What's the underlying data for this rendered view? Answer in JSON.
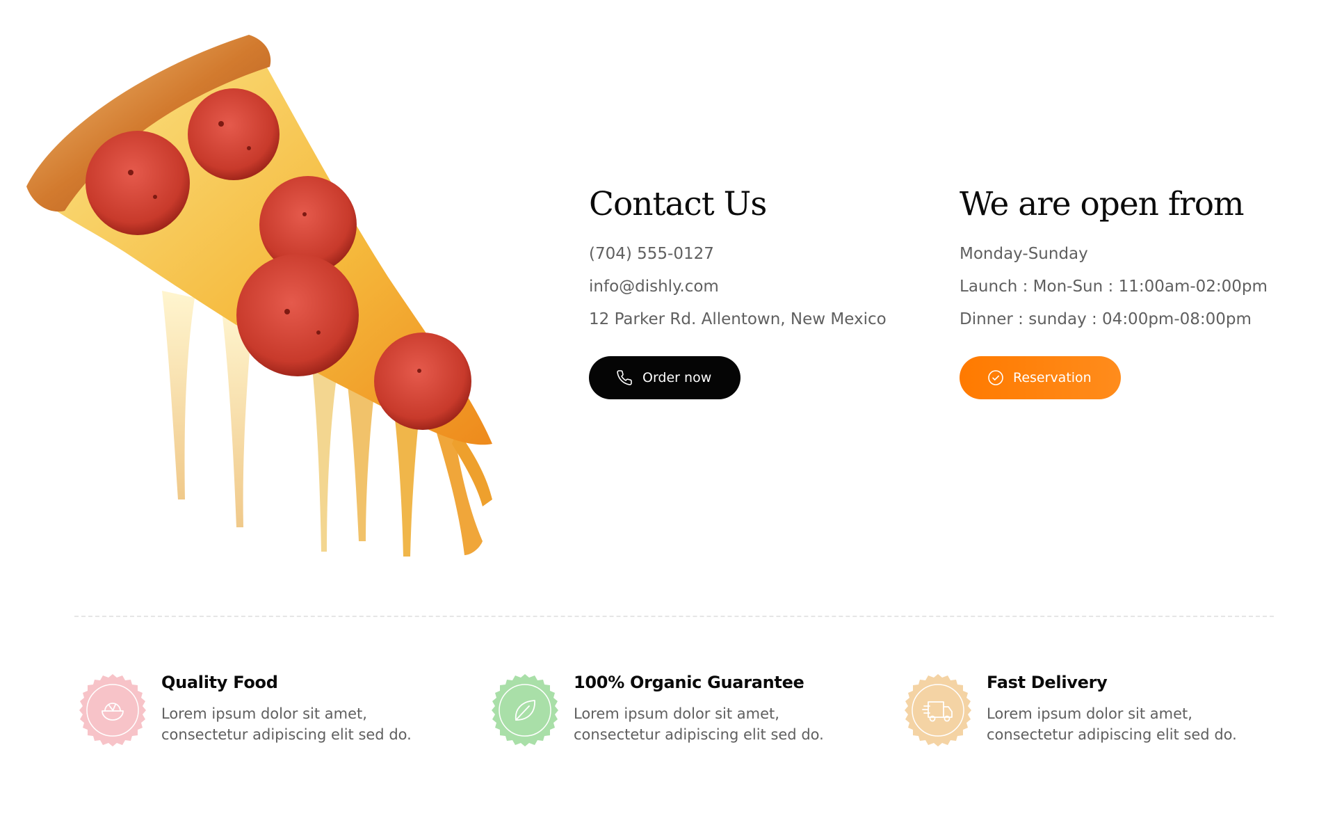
{
  "contact": {
    "heading": "Contact Us",
    "phone": "(704) 555-0127",
    "email": "info@dishly.com",
    "address": "12 Parker Rd. Allentown, New Mexico",
    "button_label": "Order now",
    "button_icon": "phone-icon"
  },
  "hours": {
    "heading": "We are open from",
    "days": "Monday-Sunday",
    "launch": "Launch : Mon-Sun : 11:00am-02:00pm",
    "dinner": "Dinner : sunday : 04:00pm-08:00pm",
    "button_label": "Reservation",
    "button_icon": "check-circle-icon",
    "accent_color": "#ff7a00"
  },
  "features": [
    {
      "title": "Quality Food",
      "line1": "Lorem ipsum dolor sit amet,",
      "line2": "consectetur adipiscing elit sed do.",
      "icon": "food-bowl-icon",
      "color": "#f7c3c8"
    },
    {
      "title": "100% Organic Guarantee",
      "line1": "Lorem ipsum dolor sit amet,",
      "line2": "consectetur adipiscing elit sed do.",
      "icon": "leaf-icon",
      "color": "#a9dfa8"
    },
    {
      "title": "Fast Delivery",
      "line1": "Lorem ipsum dolor sit amet,",
      "line2": "consectetur adipiscing elit sed do.",
      "icon": "delivery-truck-icon",
      "color": "#f4d3a4"
    }
  ]
}
